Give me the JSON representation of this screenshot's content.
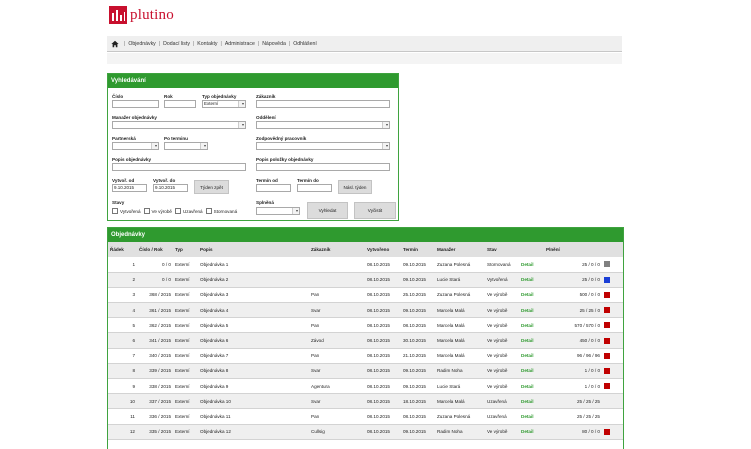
{
  "brand": {
    "name": "plutino",
    "color": "#c8102e"
  },
  "nav": {
    "home_icon": "home-icon",
    "items": [
      "Objednávky",
      "Dodací listy",
      "Kontakty",
      "Administrace",
      "Nápověda",
      "Odhlášení"
    ]
  },
  "search": {
    "title": "Vyhledávání",
    "labels": {
      "cislo": "Číslo",
      "rok": "Rok",
      "typ": "Typ objednávky",
      "zakaznik": "Zákazník",
      "manazer": "Manažer objednávky",
      "oddeleni": "Oddělení",
      "partnerska": "Partnerská",
      "po_terminu": "Po terminu",
      "zodpovedny": "Zodpovědný pracovník",
      "popis": "Popis objednávky",
      "popis_polozky": "Popis položky objednávky",
      "vytvor_od": "Vytvoř. od",
      "vytvor_do": "Vytvoř. do",
      "termin_od": "Termín od",
      "termin_do": "Termín do",
      "stavy": "Stavy",
      "splnena": "Splněná"
    },
    "values": {
      "typ": "Externí",
      "vytvor_od": "9.10.2015",
      "vytvor_do": "9.10.2015"
    },
    "buttons": {
      "tyden_zpet": "Týden zpět",
      "nasl_tyden": "Násl. týden",
      "vyhledat": "Vyhledat",
      "vycistit": "Vyčistit"
    },
    "states": [
      "Vytvořená",
      "Ve výrobě",
      "Uzavřená",
      "Stornovaná"
    ]
  },
  "orders": {
    "title": "Objednávky",
    "columns": [
      "Řádek",
      "Číslo / Rok",
      "Typ",
      "Popis",
      "Zákazník",
      "Vytvořeno",
      "Termín",
      "Manažer",
      "Stav",
      "",
      "Plnění",
      ""
    ],
    "rows": [
      {
        "radek": "1",
        "cislo": "0 / 0",
        "typ": "Externí",
        "popis": "Objednávka 1",
        "zakaznik": "",
        "vytvoreno": "08.10.2015",
        "termin": "09.10.2015",
        "manazer": "Zuzana Polesná",
        "stav": "Stornovaná",
        "detail": "Detail",
        "plneni": "25 / 0 / 0",
        "color": "#808080"
      },
      {
        "radek": "2",
        "cislo": "0 / 0",
        "typ": "Externí",
        "popis": "Objednávka 2",
        "zakaznik": "",
        "vytvoreno": "08.10.2015",
        "termin": "09.10.2015",
        "manazer": "Lucie Stará",
        "stav": "Vytvořená",
        "detail": "Detail",
        "plneni": "25 / 0 / 0",
        "color": "#1a3fd6"
      },
      {
        "radek": "3",
        "cislo": "368 / 2015",
        "typ": "Externí",
        "popis": "Objednávka 3",
        "zakaznik": "Pan",
        "vytvoreno": "08.10.2015",
        "termin": "25.10.2015",
        "manazer": "Zuzana Polesná",
        "stav": "Ve výrobě",
        "detail": "Detail",
        "plneni": "500 / 0 / 0",
        "color": "#c00000"
      },
      {
        "radek": "4",
        "cislo": "361 / 2015",
        "typ": "Externí",
        "popis": "Objednávka 4",
        "zakaznik": "Svar",
        "vytvoreno": "08.10.2015",
        "termin": "09.10.2015",
        "manazer": "Marcela Malá",
        "stav": "Ve výrobě",
        "detail": "Detail",
        "plneni": "25 / 25 / 0",
        "color": "#c00000"
      },
      {
        "radek": "5",
        "cislo": "362 / 2015",
        "typ": "Externí",
        "popis": "Objednávka 5",
        "zakaznik": "Pan",
        "vytvoreno": "08.10.2015",
        "termin": "08.10.2015",
        "manazer": "Marcela Malá",
        "stav": "Ve výrobě",
        "detail": "Detail",
        "plneni": "570 / 570 / 0",
        "color": "#c00000"
      },
      {
        "radek": "6",
        "cislo": "341 / 2015",
        "typ": "Externí",
        "popis": "Objednávka 6",
        "zakaznik": "Závod",
        "vytvoreno": "08.10.2015",
        "termin": "30.10.2015",
        "manazer": "Marcela Malá",
        "stav": "Ve výrobě",
        "detail": "Detail",
        "plneni": "450 / 0 / 0",
        "color": "#c00000"
      },
      {
        "radek": "7",
        "cislo": "340 / 2015",
        "typ": "Externí",
        "popis": "Objednávka 7",
        "zakaznik": "Pan",
        "vytvoreno": "08.10.2015",
        "termin": "21.10.2015",
        "manazer": "Marcela Malá",
        "stav": "Ve výrobě",
        "detail": "Detail",
        "plneni": "96 / 96 / 96",
        "color": "#c00000"
      },
      {
        "radek": "8",
        "cislo": "339 / 2015",
        "typ": "Externí",
        "popis": "Objednávka 8",
        "zakaznik": "Svar",
        "vytvoreno": "08.10.2015",
        "termin": "09.10.2015",
        "manazer": "Radim Noha",
        "stav": "Ve výrobě",
        "detail": "Detail",
        "plneni": "1 / 0 / 0",
        "color": "#c00000"
      },
      {
        "radek": "9",
        "cislo": "338 / 2015",
        "typ": "Externí",
        "popis": "Objednávka 9",
        "zakaznik": "Agentura",
        "vytvoreno": "08.10.2015",
        "termin": "09.10.2015",
        "manazer": "Lucie Stará",
        "stav": "Ve výrobě",
        "detail": "Detail",
        "plneni": "1 / 0 / 0",
        "color": "#c00000"
      },
      {
        "radek": "10",
        "cislo": "337 / 2015",
        "typ": "Externí",
        "popis": "Objednávka 10",
        "zakaznik": "Svar",
        "vytvoreno": "08.10.2015",
        "termin": "18.10.2015",
        "manazer": "Marcela Malá",
        "stav": "Uzavřená",
        "detail": "Detail",
        "plneni": "25 / 25 / 25",
        "color": ""
      },
      {
        "radek": "11",
        "cislo": "336 / 2015",
        "typ": "Externí",
        "popis": "Objednávka 11",
        "zakaznik": "Pan",
        "vytvoreno": "08.10.2015",
        "termin": "08.10.2015",
        "manazer": "Zuzana Polesná",
        "stav": "Uzavřená",
        "detail": "Detail",
        "plneni": "25 / 25 / 25",
        "color": ""
      },
      {
        "radek": "12",
        "cislo": "335 / 2015",
        "typ": "Externí",
        "popis": "Objednávka 12",
        "zakaznik": "Cullsig",
        "vytvoreno": "08.10.2015",
        "termin": "09.10.2015",
        "manazer": "Radim Noha",
        "stav": "Ve výrobě",
        "detail": "Detail",
        "plneni": "80 / 0 / 0",
        "color": "#c00000"
      }
    ]
  }
}
